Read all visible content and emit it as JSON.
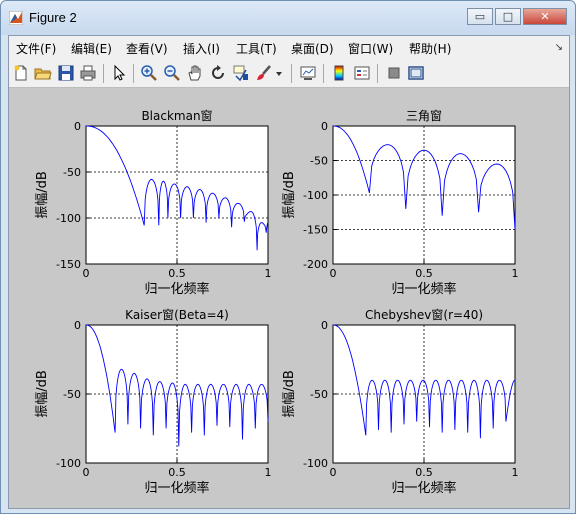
{
  "window": {
    "title": "Figure 2",
    "minimize": "▭",
    "maximize": "□",
    "close": "✕"
  },
  "menu": {
    "items": [
      "文件(F)",
      "编辑(E)",
      "查看(V)",
      "插入(I)",
      "工具(T)",
      "桌面(D)",
      "窗口(W)",
      "帮助(H)"
    ],
    "overflow_arrow": "↘"
  },
  "toolbar": {
    "buttons": [
      "new-file-icon",
      "open-folder-icon",
      "save-icon",
      "print-icon",
      "pointer-icon",
      "zoom-in-icon",
      "zoom-out-icon",
      "pan-hand-icon",
      "rotate-3d-icon",
      "data-cursor-icon",
      "brush-icon",
      "brush-dropdown-icon",
      "link-plot-icon",
      "colorbar-icon",
      "legend-icon",
      "hide-plot-tools-icon",
      "show-plot-tools-icon"
    ]
  },
  "chart_data": [
    {
      "type": "line",
      "title": "Blackman窗",
      "xlabel": "归一化频率",
      "ylabel": "振幅/dB",
      "xlim": [
        0,
        1
      ],
      "ylim": [
        -150,
        0
      ],
      "xticks": [
        "0",
        "0.5",
        "1"
      ],
      "yticks": [
        "0",
        "-50",
        "-100",
        "-150"
      ],
      "grid": "dashed",
      "color": "#0000ff",
      "mainlobe_edge": 0.32,
      "sidelobe_peaks_x": [
        0.36,
        0.41,
        0.48,
        0.55,
        0.62,
        0.69,
        0.76,
        0.83,
        0.9,
        0.97
      ],
      "sidelobe_peaks_y": [
        -58,
        -60,
        -63,
        -66,
        -69,
        -73,
        -78,
        -84,
        -93,
        -105
      ],
      "nulls_x": [
        0.32,
        0.4,
        0.45,
        0.52,
        0.59,
        0.66,
        0.73,
        0.8,
        0.87,
        0.94,
        0.99
      ],
      "nulls_y": [
        -108,
        -108,
        -100,
        -100,
        -100,
        -105,
        -100,
        -110,
        -104,
        -135,
        -116
      ]
    },
    {
      "type": "line",
      "title": "三角窗",
      "xlabel": "归一化频率",
      "ylabel": "振幅/dB",
      "xlim": [
        0,
        1
      ],
      "ylim": [
        -200,
        0
      ],
      "xticks": [
        "0",
        "0.5",
        "1"
      ],
      "yticks": [
        "0",
        "-50",
        "-100",
        "-150",
        "-200"
      ],
      "grid": "dashed",
      "color": "#0000ff",
      "mainlobe_edge": 0.2,
      "sidelobe_peaks_x": [
        0.29,
        0.5,
        0.7,
        0.9
      ],
      "sidelobe_peaks_y": [
        -27,
        -35,
        -40,
        -55
      ],
      "nulls_x": [
        0.2,
        0.4,
        0.6,
        0.8,
        1.0
      ],
      "nulls_y": [
        -97,
        -120,
        -130,
        -125,
        -150
      ]
    },
    {
      "type": "line",
      "title": "Kaiser窗(Beta=4)",
      "xlabel": "归一化频率",
      "ylabel": "振幅/dB",
      "xlim": [
        0,
        1
      ],
      "ylim": [
        -100,
        0
      ],
      "xticks": [
        "0",
        "0.5",
        "1"
      ],
      "yticks": [
        "0",
        "-50",
        "-100"
      ],
      "grid": "dashed",
      "color": "#0000ff",
      "mainlobe_edge": 0.16,
      "sidelobe_peaks_x": [
        0.2,
        0.26,
        0.33,
        0.4,
        0.47,
        0.54,
        0.61,
        0.68,
        0.75,
        0.82,
        0.89,
        0.96
      ],
      "sidelobe_peaks_y": [
        -32,
        -35,
        -39,
        -41,
        -42,
        -43,
        -43,
        -43,
        -43,
        -43,
        -43,
        -43
      ],
      "nulls_x": [
        0.16,
        0.23,
        0.3,
        0.37,
        0.44,
        0.51,
        0.58,
        0.65,
        0.72,
        0.79,
        0.86,
        0.93,
        1.0
      ],
      "nulls_y": [
        -78,
        -72,
        -75,
        -80,
        -75,
        -88,
        -78,
        -80,
        -73,
        -74,
        -83,
        -75,
        -70
      ]
    },
    {
      "type": "line",
      "title": "Chebyshev窗(r=40)",
      "xlabel": "归一化频率",
      "ylabel": "振幅/dB",
      "xlim": [
        0,
        1
      ],
      "ylim": [
        -100,
        0
      ],
      "xticks": [
        "0",
        "0.5",
        "1"
      ],
      "yticks": [
        "0",
        "-50",
        "-100"
      ],
      "grid": "dashed",
      "color": "#0000ff",
      "mainlobe_edge": 0.18,
      "sidelobe_peaks_x": [
        0.21,
        0.28,
        0.35,
        0.42,
        0.49,
        0.56,
        0.63,
        0.7,
        0.77,
        0.84,
        0.91,
        0.98
      ],
      "sidelobe_peaks_y": [
        -40,
        -40,
        -40,
        -40,
        -40,
        -40,
        -40,
        -40,
        -40,
        -40,
        -40,
        -40
      ],
      "nulls_x": [
        0.18,
        0.25,
        0.32,
        0.39,
        0.46,
        0.53,
        0.6,
        0.67,
        0.74,
        0.81,
        0.88,
        0.95
      ],
      "nulls_y": [
        -80,
        -76,
        -78,
        -72,
        -70,
        -74,
        -78,
        -76,
        -78,
        -82,
        -75,
        -70
      ]
    }
  ]
}
